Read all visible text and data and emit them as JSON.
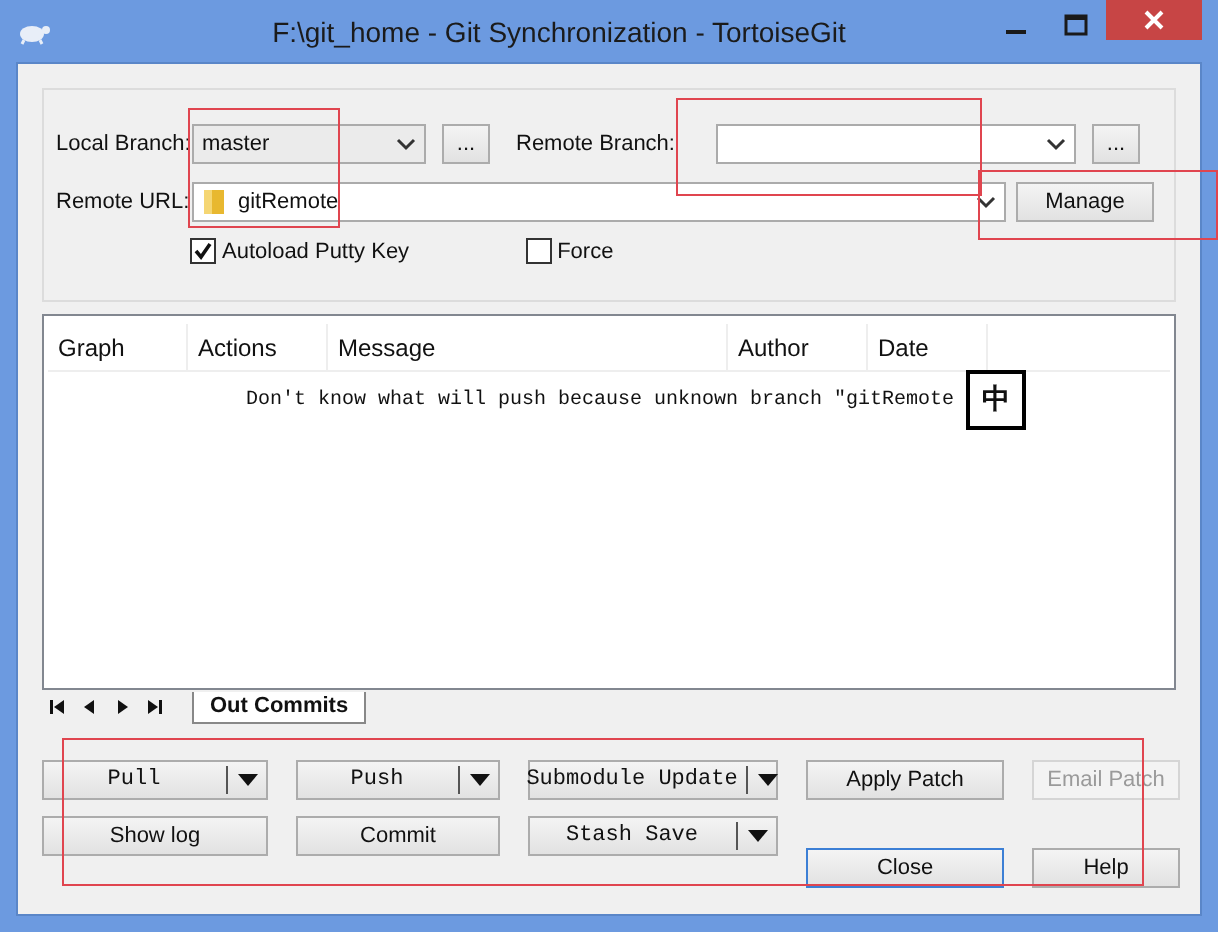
{
  "window": {
    "title": "F:\\git_home - Git Synchronization - TortoiseGit"
  },
  "local_branch": {
    "label": "Local Branch:",
    "value": "master",
    "browse": "..."
  },
  "remote_branch": {
    "label": "Remote Branch:",
    "browse": "..."
  },
  "remote_url": {
    "label": "Remote URL:",
    "value": "gitRemote",
    "manage": "Manage"
  },
  "options": [
    {
      "label": "Autoload Putty Key",
      "checked": true
    },
    {
      "label": "Force",
      "checked": false
    }
  ],
  "table": {
    "columns": [
      "Graph",
      "Actions",
      "Message",
      "Author",
      "Date"
    ],
    "message": "Don't know what will push because unknown branch \"gitRemote"
  },
  "ime_indicator": "中",
  "tabs": [
    {
      "label": "Out Commits",
      "selected": true
    }
  ],
  "buttons": [
    {
      "label": "Pull",
      "kind": "split",
      "disabled": false
    },
    {
      "label": "Push",
      "kind": "split",
      "disabled": false
    },
    {
      "label": "Submodule Update",
      "kind": "split",
      "disabled": false
    },
    {
      "label": "Apply Patch",
      "kind": "plain",
      "disabled": false
    },
    {
      "label": "Email Patch",
      "kind": "plain",
      "disabled": true
    },
    {
      "label": "Show log",
      "kind": "plain",
      "disabled": false
    },
    {
      "label": "Commit",
      "kind": "plain",
      "disabled": false
    },
    {
      "label": "Stash Save",
      "kind": "split",
      "disabled": false
    }
  ],
  "dialog_buttons": [
    {
      "label": "Close",
      "focused": true
    },
    {
      "label": "Help",
      "focused": false
    }
  ]
}
